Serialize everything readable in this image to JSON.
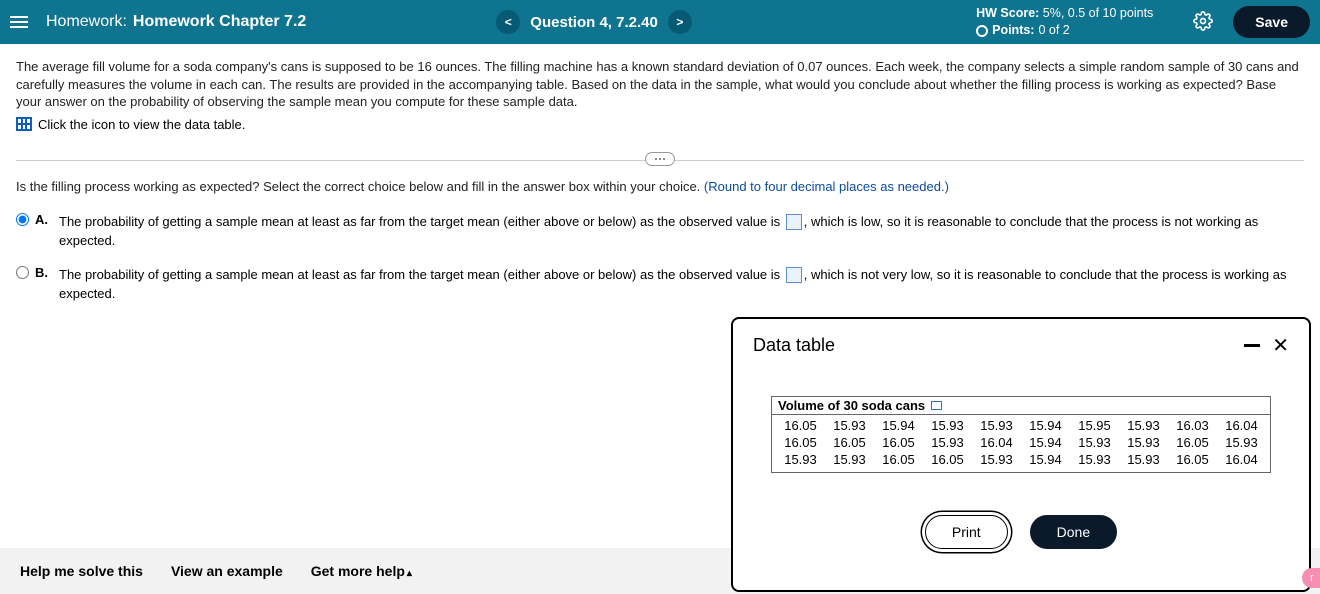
{
  "header": {
    "homework_label": "Homework:",
    "homework_title": "Homework Chapter 7.2",
    "prev_symbol": "<",
    "next_symbol": ">",
    "question_label": "Question 4, 7.2.40",
    "hw_score_label": "HW Score:",
    "hw_score_value": "5%, 0.5 of 10 points",
    "points_label": "Points:",
    "points_value": "0 of 2",
    "save_label": "Save"
  },
  "problem": {
    "text": "The average fill volume for a soda company's cans is supposed to be 16 ounces. The filling machine has a known standard deviation of 0.07 ounces. Each week, the company selects a simple random sample of 30 cans and carefully measures the volume in each can. The results are provided in the accompanying table. Based on the data in the sample, what would you conclude about whether the filling process is working as expected? Base your answer on the probability of observing the sample mean you compute for these sample data.",
    "data_link": "Click the icon to view the data table."
  },
  "prompt": {
    "lead": "Is the filling process working as expected? Select the correct choice below and fill in the answer box within your choice. ",
    "note": "(Round to four decimal places as needed.)"
  },
  "choices": {
    "a_letter": "A.",
    "a_before": "The probability of getting a sample mean at least as far from the target mean (either above or below) as the observed value is ",
    "a_after": ", which is low, so it is reasonable to conclude that the process is not working as expected.",
    "b_letter": "B.",
    "b_before": "The probability of getting a sample mean at least as far from the target mean (either above or below) as the observed value is ",
    "b_after": ", which is not very low, so it is reasonable to conclude that the process is working as expected."
  },
  "footer": {
    "help": "Help me solve this",
    "example": "View an example",
    "more": "Get more help",
    "caret": "▴"
  },
  "popup": {
    "title": "Data table",
    "table_title": "Volume of 30 soda cans",
    "print": "Print",
    "done": "Done",
    "values": [
      "16.05",
      "15.93",
      "15.94",
      "15.93",
      "15.93",
      "15.94",
      "15.95",
      "15.93",
      "16.03",
      "16.04",
      "16.05",
      "16.05",
      "16.05",
      "15.93",
      "16.04",
      "15.94",
      "15.93",
      "15.93",
      "16.05",
      "15.93",
      "15.93",
      "15.93",
      "16.05",
      "16.05",
      "15.93",
      "15.94",
      "15.93",
      "15.93",
      "16.05",
      "16.04"
    ]
  },
  "misc": {
    "pink": "r"
  }
}
